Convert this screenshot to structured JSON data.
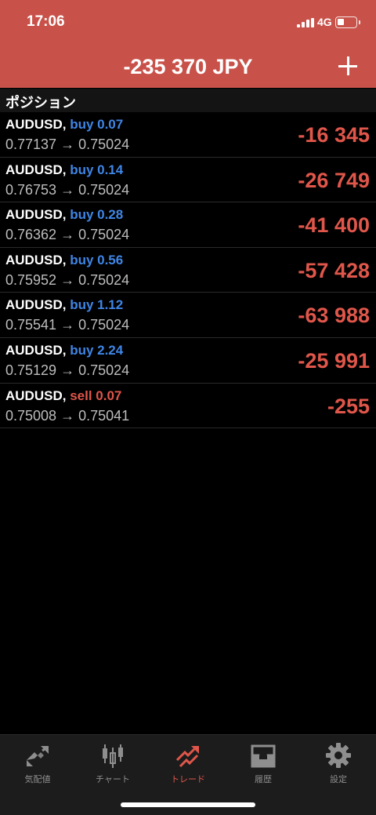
{
  "status": {
    "time": "17:06",
    "network": "4G"
  },
  "header": {
    "total": "-235 370 JPY"
  },
  "section": {
    "title": "ポジション"
  },
  "positions": [
    {
      "symbol": "AUDUSD,",
      "side": "buy",
      "side_label": "buy 0.07",
      "prices": "0.77137 → 0.75024",
      "pnl": "-16 345"
    },
    {
      "symbol": "AUDUSD,",
      "side": "buy",
      "side_label": "buy 0.14",
      "prices": "0.76753 → 0.75024",
      "pnl": "-26 749"
    },
    {
      "symbol": "AUDUSD,",
      "side": "buy",
      "side_label": "buy 0.28",
      "prices": "0.76362 → 0.75024",
      "pnl": "-41 400"
    },
    {
      "symbol": "AUDUSD,",
      "side": "buy",
      "side_label": "buy 0.56",
      "prices": "0.75952 → 0.75024",
      "pnl": "-57 428"
    },
    {
      "symbol": "AUDUSD,",
      "side": "buy",
      "side_label": "buy 1.12",
      "prices": "0.75541 → 0.75024",
      "pnl": "-63 988"
    },
    {
      "symbol": "AUDUSD,",
      "side": "buy",
      "side_label": "buy 2.24",
      "prices": "0.75129 → 0.75024",
      "pnl": "-25 991"
    },
    {
      "symbol": "AUDUSD,",
      "side": "sell",
      "side_label": "sell 0.07",
      "prices": "0.75008 → 0.75041",
      "pnl": "-255"
    }
  ],
  "tabbar": {
    "items": [
      {
        "label": "気配値",
        "icon": "quotes-icon",
        "active": false
      },
      {
        "label": "チャート",
        "icon": "chart-candles-icon",
        "active": false
      },
      {
        "label": "トレード",
        "icon": "trade-icon",
        "active": true
      },
      {
        "label": "履歴",
        "icon": "history-inbox-icon",
        "active": false
      },
      {
        "label": "設定",
        "icon": "gear-icon",
        "active": false
      }
    ]
  },
  "colors": {
    "header_bg": "#c8524a",
    "buy": "#3f86e6",
    "sell": "#e0564a",
    "loss": "#e0564a",
    "tab_active": "#e0564a",
    "tab_inactive": "#8e8e8e"
  }
}
